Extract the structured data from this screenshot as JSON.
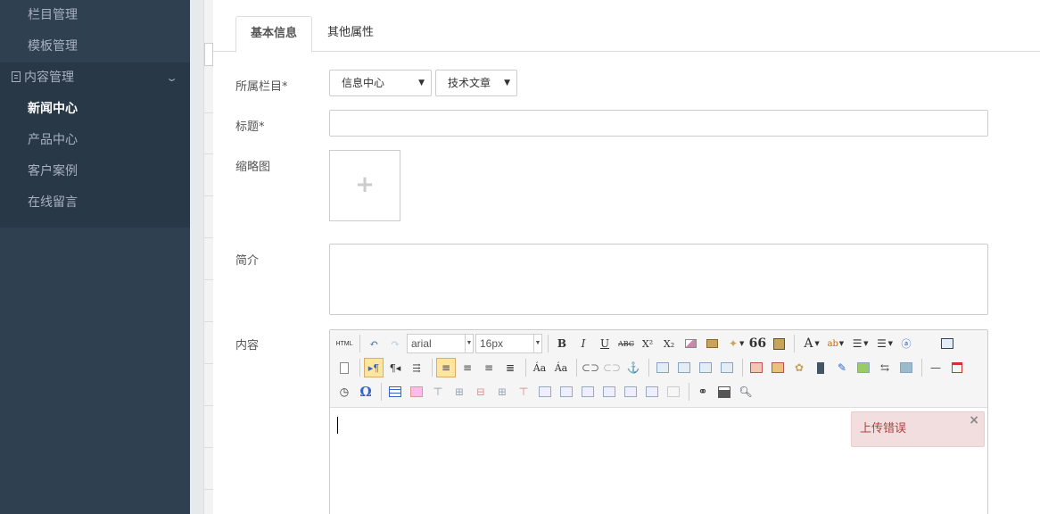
{
  "sidebar": {
    "top_items": [
      "栏目管理",
      "模板管理"
    ],
    "group": {
      "label": "内容管理",
      "chevron": "chevron-down-icon"
    },
    "sub_items": [
      {
        "label": "新闻中心",
        "active": true
      },
      {
        "label": "产品中心",
        "active": false
      },
      {
        "label": "客户案例",
        "active": false
      },
      {
        "label": "在线留言",
        "active": false
      }
    ]
  },
  "tabs": [
    "基本信息",
    "其他属性"
  ],
  "form": {
    "category_label": "所属栏目*",
    "category_select_1": "信息中心",
    "category_select_2": "技术文章",
    "title_label": "标题*",
    "title_value": "",
    "thumb_label": "缩略图",
    "thumb_plus": "+",
    "summary_label": "简介",
    "summary_value": "",
    "content_label": "内容"
  },
  "editor": {
    "html_label": "HTML",
    "font_family": "arial",
    "font_size": "16px",
    "bold": "B",
    "italic": "I",
    "underline": "U",
    "strike": "ABC",
    "superscript": "X²",
    "subscript": "X₂",
    "quote": "66",
    "font_color": "A",
    "omega": "Ω"
  },
  "toast": {
    "message": "上传错误",
    "close": "×"
  },
  "colors": {
    "sidebar_bg": "#2f4050",
    "sidebar_sub_bg": "#293846",
    "error_bg": "#f2dede",
    "error_text": "#a94442"
  }
}
